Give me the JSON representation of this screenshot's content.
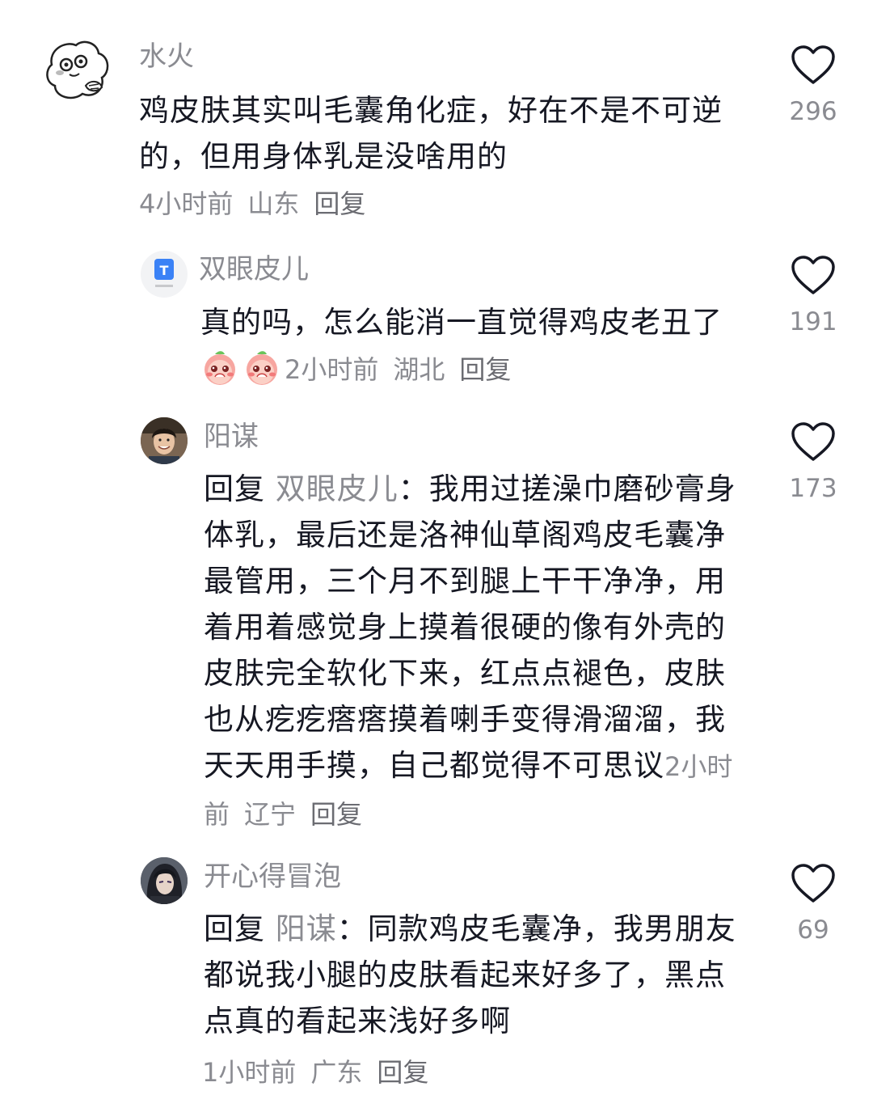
{
  "comments": [
    {
      "username": "水火",
      "text": "鸡皮肤其实叫毛囊角化症，好在不是不可逆的，但用身体乳是没啥用的",
      "time": "4小时前",
      "location": "山东",
      "reply_label": "回复",
      "likes": "296",
      "avatar_icon": "cartoon-face-icon"
    },
    {
      "username": "双眼皮儿",
      "text": "真的吗，怎么能消一直觉得鸡皮老丑了",
      "emojis": [
        "peach-shy-emoji",
        "peach-shy-emoji"
      ],
      "time": "2小时前",
      "location": "湖北",
      "reply_label": "回复",
      "likes": "191",
      "avatar_icon": "document-t-icon"
    },
    {
      "username": "阳谋",
      "reply_prefix": "回复",
      "reply_target": "双眼皮儿",
      "text": "：我用过搓澡巾磨砂膏身体乳，最后还是洛神仙草阁鸡皮毛囊净最管用，三个月不到腿上干干净净，用着用着感觉身上摸着很硬的像有外壳的皮肤完全软化下来，红点点褪色，皮肤也从疙疙瘩瘩摸着喇手变得滑溜溜，我天天用手摸，自己都觉得不可思议",
      "time": "2小时前",
      "location": "辽宁",
      "reply_label": "回复",
      "likes": "173",
      "avatar_icon": "user-photo-avatar"
    },
    {
      "username": "开心得冒泡",
      "reply_prefix": "回复",
      "reply_target": "阳谋",
      "text": "：同款鸡皮毛囊净，我男朋友都说我小腿的皮肤看起来好多了，黑点点真的看起来浅好多啊",
      "time": "1小时前",
      "location": "广东",
      "reply_label": "回复",
      "likes": "69",
      "avatar_icon": "anime-character-avatar"
    }
  ],
  "colors": {
    "text": "#161823",
    "secondary": "#8a8b91",
    "heart_stroke": "#161823"
  }
}
